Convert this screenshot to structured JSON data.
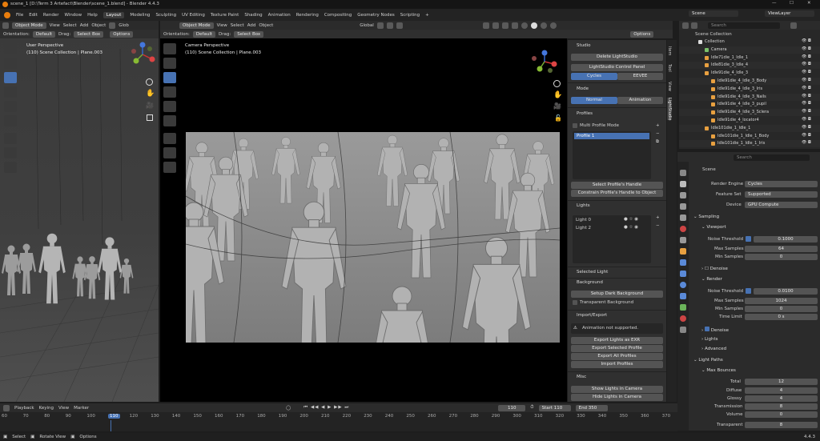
{
  "title": "scene_1 [D:\\Term 3 Artefact\\Blender\\scene_1.blend] - Blender 4.4.3",
  "menu": [
    "File",
    "Edit",
    "Render",
    "Window",
    "Help"
  ],
  "workspaces": [
    "Layout",
    "Modeling",
    "Sculpting",
    "UV Editing",
    "Texture Paint",
    "Shading",
    "Animation",
    "Rendering",
    "Compositing",
    "Geometry Nodes",
    "Scripting"
  ],
  "top_right": {
    "scene": "Scene",
    "view_layer": "ViewLayer"
  },
  "left_vp": {
    "mode": "Object Mode",
    "menus": [
      "View",
      "Select",
      "Add",
      "Object"
    ],
    "glob": "Glob",
    "orientation_label": "Orientation:",
    "orientation": "Default",
    "drag_label": "Drag:",
    "drag": "Select Box",
    "options": "Options",
    "persp": "User Perspective",
    "coll": "(110) Scene Collection | Plane.003"
  },
  "center_vp": {
    "mode": "Object Mode",
    "menus": [
      "View",
      "Select",
      "Add",
      "Object"
    ],
    "global": "Global",
    "orientation_label": "Orientation:",
    "orientation": "Default",
    "drag_label": "Drag:",
    "drag": "Select Box",
    "options": "Options",
    "persp": "Camera Perspective",
    "coll": "(110) Scene Collection | Plane.003"
  },
  "vtabs": [
    "Item",
    "Tool",
    "View",
    "LightStudio"
  ],
  "studio": {
    "studio_title": "Studio",
    "delete": "Delete LightStudio",
    "control": "LightStudio Control Panel",
    "cycles": "Cycles",
    "eevee": "EEVEE",
    "mode_title": "Mode",
    "normal": "Normal",
    "animation": "Animation",
    "profiles_title": "Profiles",
    "multi": "Multi Profile Mode",
    "profile1": "Profile 1",
    "select_handle": "Select Profile's Handle",
    "constrain": "Constrain Profile's Handle to Object",
    "lights_title": "Lights",
    "light0": "Light 0",
    "light2": "Light 2",
    "selected_light": "Selected Light",
    "background_title": "Background",
    "setup_dark": "Setup Dark Background",
    "transparent_bg": "Transparent Background",
    "ie_title": "Import/Export",
    "warn": "Animation not supported.",
    "exr": "Export Lights as EXR",
    "export_sel": "Export Selected Profile",
    "export_all": "Export All Profiles",
    "import": "Import Profiles",
    "misc_title": "Misc",
    "show_cam": "Show Lights in Camera",
    "hide_cam": "Hide Lights in Camera"
  },
  "outliner": {
    "search": "Search",
    "root": "Scene Collection",
    "items": [
      {
        "name": "Collection",
        "indent": 0
      },
      {
        "name": "Camera",
        "indent": 1
      },
      {
        "name": "Idle71die_1_Idle_1",
        "indent": 1
      },
      {
        "name": "Idle81die_3_Idle_4",
        "indent": 1
      },
      {
        "name": "Idle91die_4_Idle_3",
        "indent": 1
      },
      {
        "name": "Idle91die_4_Idle_3_Body",
        "indent": 2
      },
      {
        "name": "Idle91die_4_Idle_3_Iris",
        "indent": 2
      },
      {
        "name": "Idle91die_4_Idle_3_Nails",
        "indent": 2
      },
      {
        "name": "Idle91die_4_Idle_3_pupil",
        "indent": 2
      },
      {
        "name": "Idle91die_4_Idle_3_Sclera",
        "indent": 2
      },
      {
        "name": "Idle91die_4_locator4",
        "indent": 2
      },
      {
        "name": "Idle101die_1_Idle_1",
        "indent": 1
      },
      {
        "name": "Idle101die_1_Idle_1_Body",
        "indent": 2
      },
      {
        "name": "Idle101die_1_Idle_1_Iris",
        "indent": 2
      }
    ]
  },
  "props": {
    "search": "Search",
    "scene": "Scene",
    "render_engine_label": "Render Engine",
    "render_engine": "Cycles",
    "feature_set_label": "Feature Set",
    "feature_set": "Supported",
    "device_label": "Device",
    "device": "GPU Compute",
    "sampling": "Sampling",
    "viewport": "Viewport",
    "noise_label": "Noise Threshold",
    "vp_noise": "0.1000",
    "max_samples_label": "Max Samples",
    "vp_max": "64",
    "min_samples_label": "Min Samples",
    "vp_min": "0",
    "denoise": "Denoise",
    "render": "Render",
    "r_noise": "0.0100",
    "r_max": "1024",
    "r_min": "0",
    "time_limit_label": "Time Limit",
    "r_time": "0 s",
    "lights": "Lights",
    "advanced": "Advanced",
    "light_paths": "Light Paths",
    "max_bounces": "Max Bounces",
    "total_label": "Total",
    "total": "12",
    "diffuse_label": "Diffuse",
    "diffuse": "4",
    "glossy_label": "Glossy",
    "glossy": "4",
    "transmission_label": "Transmission",
    "transmission": "8",
    "volume_label": "Volume",
    "volume": "0",
    "transparent_label": "Transparent",
    "transparent": "8"
  },
  "timeline": {
    "menus": [
      "Playback",
      "Keying",
      "View",
      "Marker"
    ],
    "frame": "110",
    "start_label": "Start",
    "start": "110",
    "end_label": "End",
    "end": "350",
    "ticks": [
      "60",
      "70",
      "80",
      "90",
      "100",
      "110",
      "120",
      "130",
      "140",
      "150",
      "160",
      "170",
      "180",
      "190",
      "200",
      "210",
      "220",
      "230",
      "240",
      "250",
      "260",
      "270",
      "280",
      "290",
      "300",
      "310",
      "320",
      "330",
      "340",
      "350",
      "360",
      "370"
    ]
  },
  "status": {
    "select": "Select",
    "rotate": "Rotate View",
    "options": "Options",
    "version": "4.4.3"
  }
}
